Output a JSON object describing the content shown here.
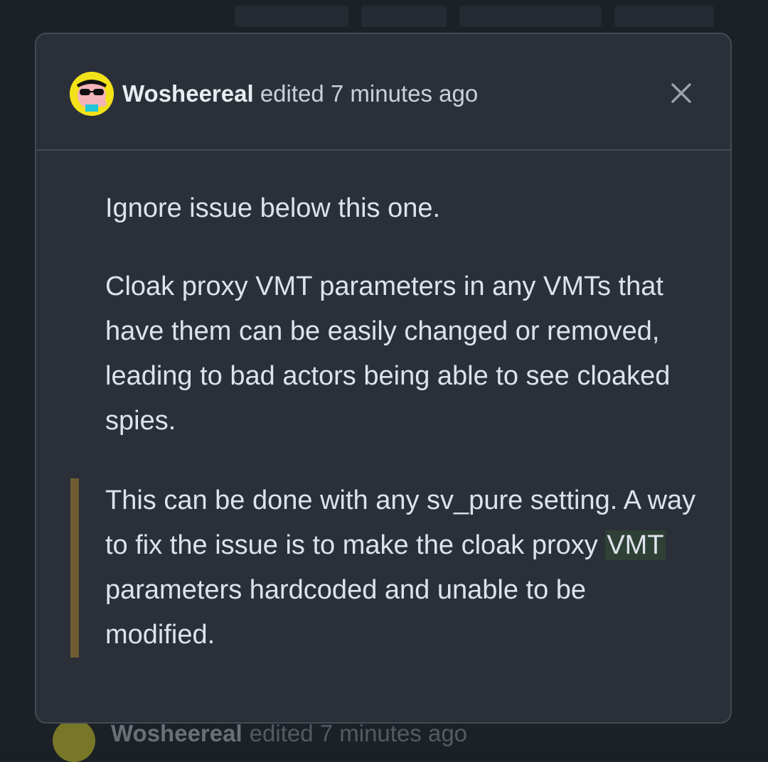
{
  "colors": {
    "background": "#1c2027",
    "modal": "#2b3038",
    "border": "#444a53",
    "text": "#dde3ea",
    "quote_bar": "#6f5c33",
    "highlight": "#2f4036",
    "avatar_yellow": "#f2e21a"
  },
  "header": {
    "author": "Wosheereal",
    "edited_text": "edited 7 minutes ago",
    "close_icon": "close-icon"
  },
  "body": {
    "paragraph1": "Ignore issue below this one.",
    "paragraph2": "Cloak proxy VMT parameters in any VMTs that have them can be easily changed or removed, leading to bad actors being able to see cloaked spies.",
    "quote": {
      "before": "This can be done with any sv_pure setting. A way to fix the issue is to make the cloak proxy ",
      "highlight": "VMT",
      "after": " parameters hardcoded and unable to be modified."
    }
  },
  "background_row": {
    "author": "Wosheereal",
    "edited_text": "edited 7 minutes ago"
  }
}
